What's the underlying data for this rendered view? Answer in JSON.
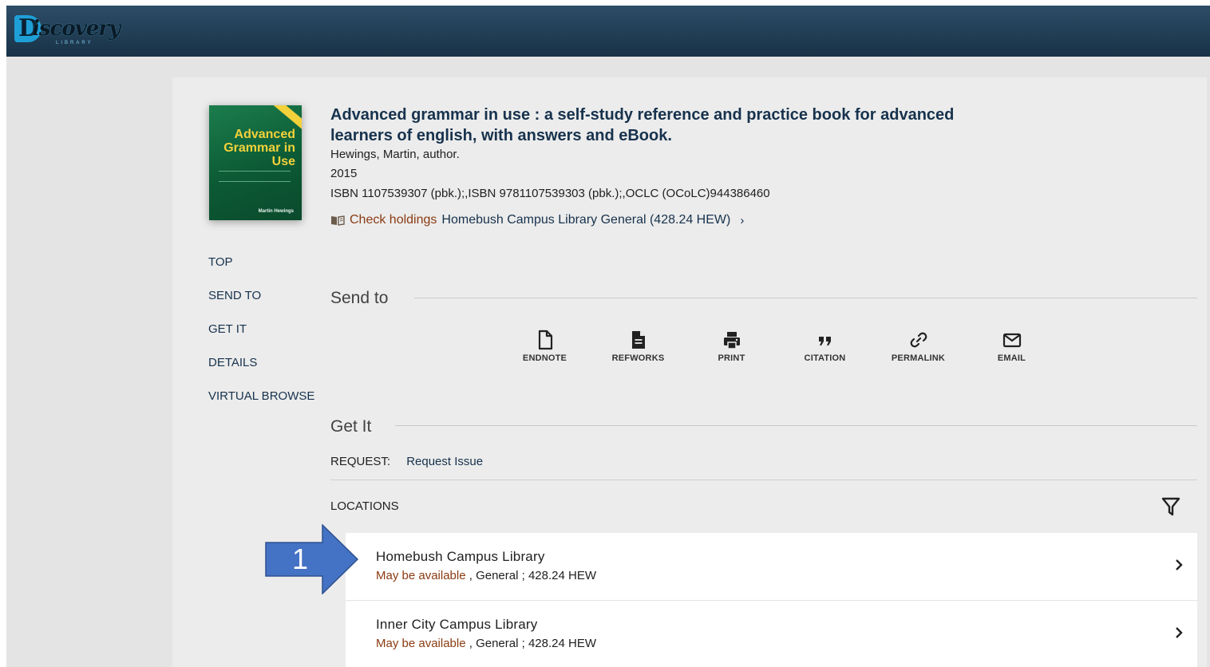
{
  "header": {
    "logo_letter": "D",
    "logo_text": "iscovery",
    "logo_subtext": "LIBRARY"
  },
  "cover": {
    "title": "Advanced Grammar in Use",
    "author": "Martin Hewings"
  },
  "record": {
    "title": "Advanced grammar in use : a self-study reference and practice book for advanced learners of english, with answers and eBook.",
    "author": "Hewings, Martin, author.",
    "year": "2015",
    "identifiers": "ISBN 1107539307 (pbk.);,ISBN 9781107539303 (pbk.);,OCLC (OCoLC)944386460",
    "check_holdings_label": "Check holdings",
    "holdings_location": "Homebush Campus Library  General (428.24 HEW)",
    "holdings_chevron": "›"
  },
  "sidenav": [
    "TOP",
    "SEND TO",
    "GET IT",
    "DETAILS",
    "VIRTUAL BROWSE"
  ],
  "send_to": {
    "title": "Send to",
    "actions": [
      {
        "label": "ENDNOTE",
        "icon": "document-outline-icon"
      },
      {
        "label": "REFWORKS",
        "icon": "document-filled-icon"
      },
      {
        "label": "PRINT",
        "icon": "printer-icon"
      },
      {
        "label": "CITATION",
        "icon": "quote-icon"
      },
      {
        "label": "PERMALINK",
        "icon": "link-icon"
      },
      {
        "label": "EMAIL",
        "icon": "envelope-icon"
      }
    ]
  },
  "get_it": {
    "title": "Get It",
    "request_label": "REQUEST:",
    "request_link": "Request Issue",
    "locations_label": "LOCATIONS",
    "locations": [
      {
        "name": "Homebush Campus Library",
        "status": "May be available",
        "detail": " , General ; 428.24 HEW"
      },
      {
        "name": "Inner City Campus Library",
        "status": "May be available",
        "detail": " , General ; 428.24 HEW"
      }
    ]
  },
  "annotation": {
    "number": "1",
    "color": "#4472c4"
  },
  "colors": {
    "link": "#17324d",
    "availability": "#8a3b12",
    "header": "#1f3c53"
  }
}
